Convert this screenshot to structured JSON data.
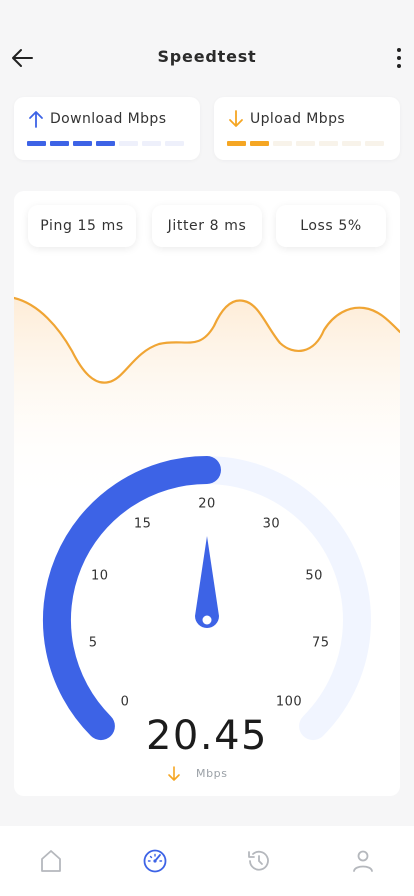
{
  "header": {
    "title": "Speedtest"
  },
  "download": {
    "label": "Download Mbps",
    "filled": 4,
    "total": 7,
    "color": "#3d63e6",
    "empty_color": "#eef0fb"
  },
  "upload": {
    "label": "Upload Mbps",
    "filled": 2,
    "total": 7,
    "color": "#f5a623",
    "empty_color": "#f8f3ea"
  },
  "metrics": {
    "ping": "Ping 15 ms",
    "jitter": "Jitter 8 ms",
    "loss": "Loss 5%"
  },
  "gauge": {
    "ticks": [
      "0",
      "5",
      "10",
      "15",
      "20",
      "30",
      "50",
      "75",
      "100"
    ],
    "value_fraction": 0.5,
    "needle_value": "20",
    "accent": "#3d63e6",
    "track": "#f1f5ff"
  },
  "reading": {
    "value": "20.45",
    "unit": "Mbps"
  },
  "nav": {
    "items": [
      "home-icon",
      "speedometer-icon",
      "history-icon",
      "profile-icon"
    ],
    "active": "speedometer-icon"
  }
}
